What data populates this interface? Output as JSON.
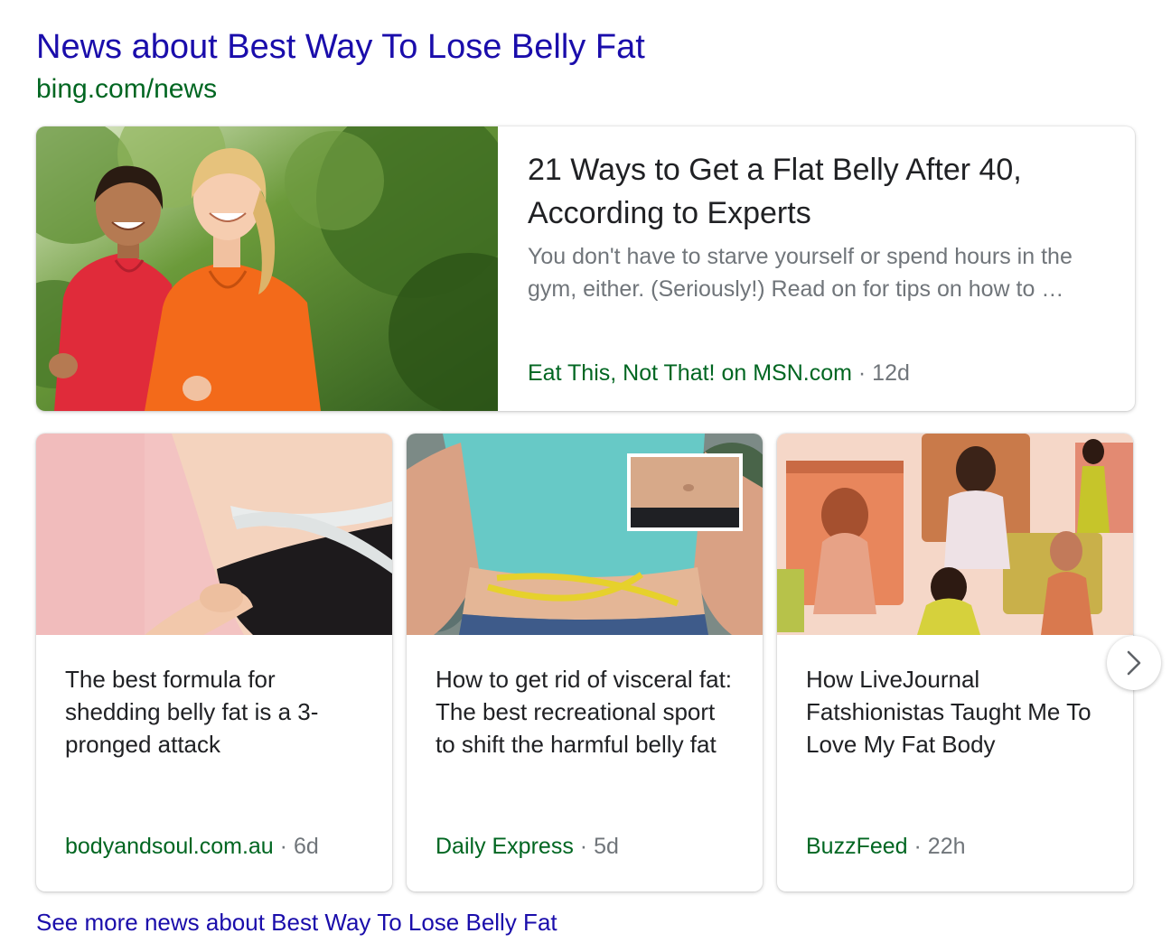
{
  "section": {
    "title": "News about Best Way To Lose Belly Fat",
    "source": "bing.com/news"
  },
  "featured": {
    "headline": "21 Ways to Get a Flat Belly After 40, According to Experts",
    "snippet": "You don't have to starve yourself or spend hours in the gym, either. (Seriously!) Read on for tips on how to …",
    "source": "Eat This, Not That! on MSN.com",
    "separator": "·",
    "age": "12d"
  },
  "articles": [
    {
      "headline": "The best formula for shedding belly fat is a 3-pronged attack",
      "source": "bodyandsoul.com.au",
      "separator": "·",
      "age": "6d"
    },
    {
      "headline": "How to get rid of visceral fat: The best recreational sport to shift the harmful belly fat",
      "source": "Daily Express",
      "separator": "·",
      "age": "5d"
    },
    {
      "headline": "How LiveJournal Fatshionistas Taught Me To Love My Fat Body",
      "source": "BuzzFeed",
      "separator": "·",
      "age": "22h"
    }
  ],
  "carousel": {
    "next_icon": "chevron-right-icon"
  },
  "footer": {
    "see_more": "See more news about Best Way To Lose Belly Fat"
  },
  "colors": {
    "link_blue": "#1a0dab",
    "source_green": "#006621",
    "meta_grey": "#70757a",
    "headline_dark": "#202124"
  }
}
